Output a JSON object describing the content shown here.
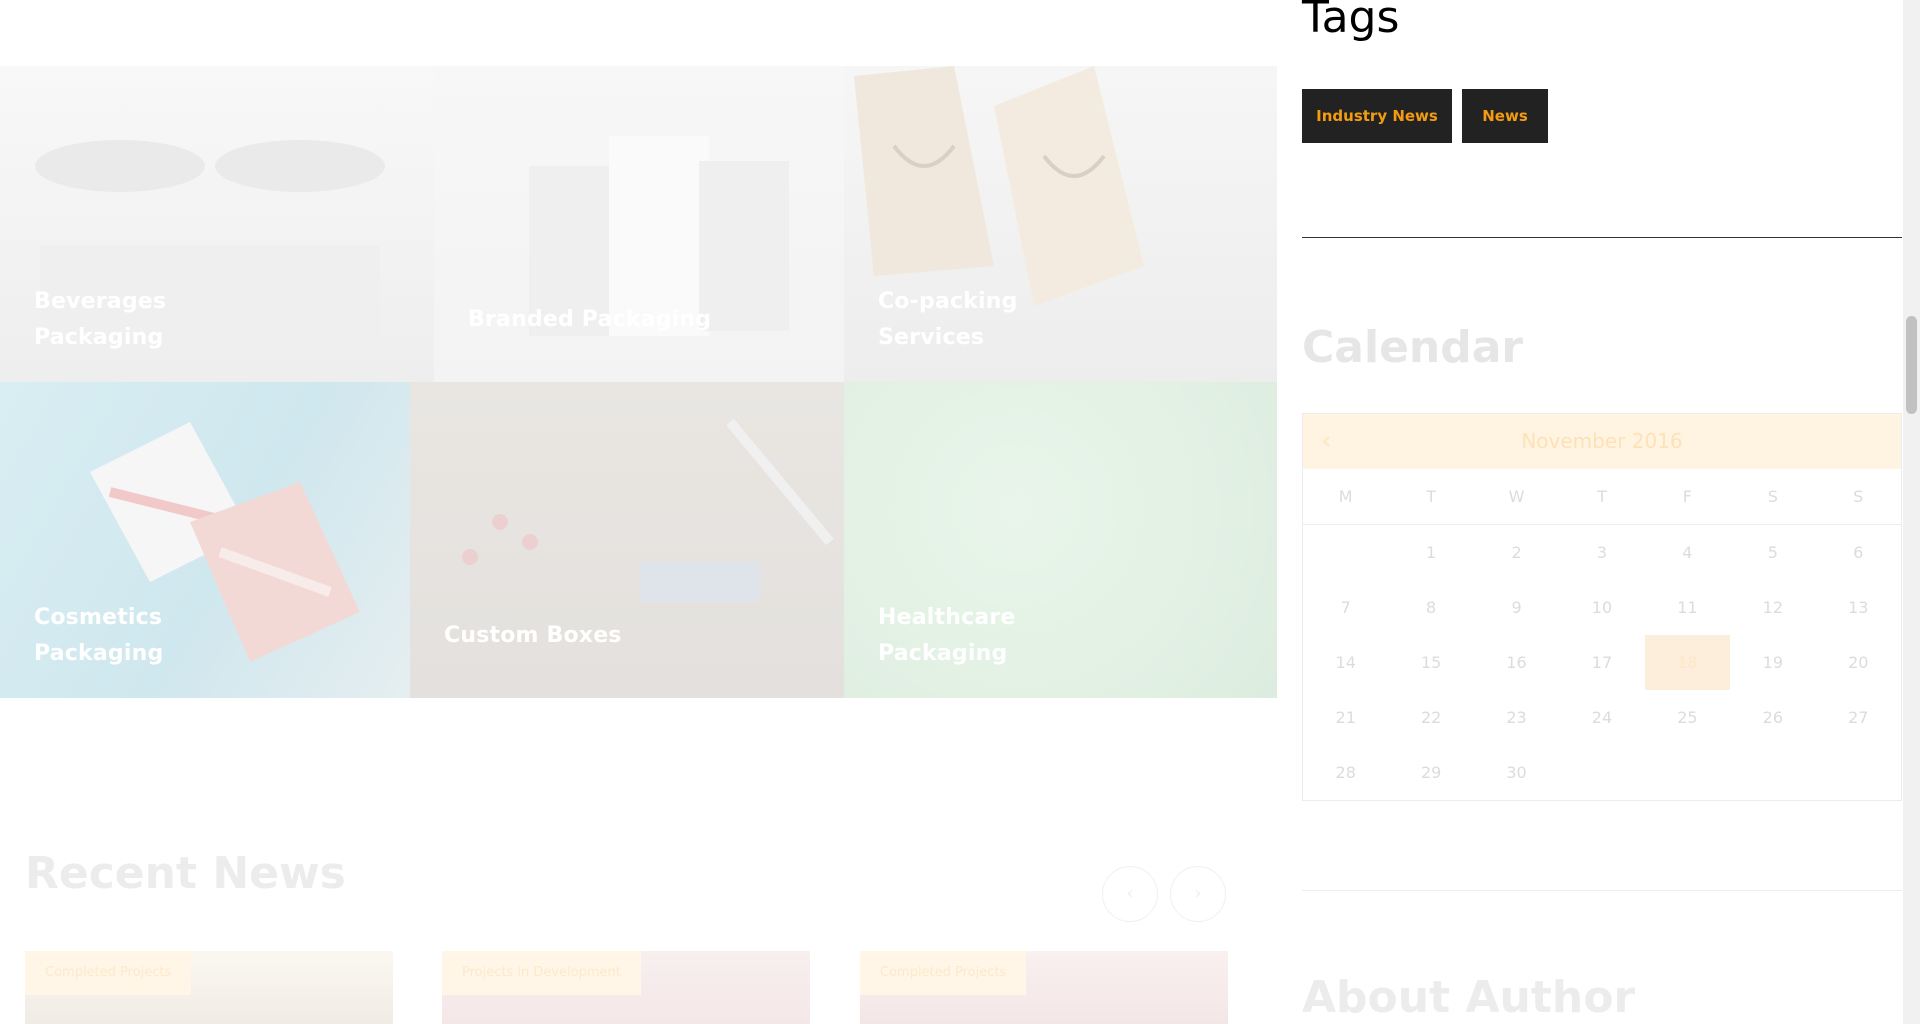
{
  "categories": [
    {
      "label": "Beverages Packaging"
    },
    {
      "label": "Branded Packaging"
    },
    {
      "label": "Co-packing Services"
    },
    {
      "label": "Cosmetics Packaging"
    },
    {
      "label": "Custom Boxes"
    },
    {
      "label": "Healthcare Packaging"
    }
  ],
  "recent_news": {
    "title": "Recent News",
    "prev_icon": "‹",
    "next_icon": "›",
    "cards": [
      {
        "badge": "Completed Projects"
      },
      {
        "badge": "Projects in Development"
      },
      {
        "badge": "Completed Projects"
      }
    ]
  },
  "sidebar": {
    "tags_title": "Tags",
    "tags": [
      "Industry News",
      "News"
    ],
    "calendar_title": "Calendar",
    "calendar": {
      "prev_icon": "‹",
      "month": "November 2016",
      "weekdays": [
        "M",
        "T",
        "W",
        "T",
        "F",
        "S",
        "S"
      ],
      "weeks": [
        [
          "",
          "1",
          "2",
          "3",
          "4",
          "5",
          "6"
        ],
        [
          "7",
          "8",
          "9",
          "10",
          "11",
          "12",
          "13"
        ],
        [
          "14",
          "15",
          "16",
          "17",
          "18",
          "19",
          "20"
        ],
        [
          "21",
          "22",
          "23",
          "24",
          "25",
          "26",
          "27"
        ],
        [
          "28",
          "29",
          "30",
          "",
          "",
          "",
          ""
        ]
      ],
      "today": "18"
    },
    "author_title": "About Author"
  },
  "colors": {
    "accent": "#f39c12",
    "tag_bg": "#222222"
  }
}
